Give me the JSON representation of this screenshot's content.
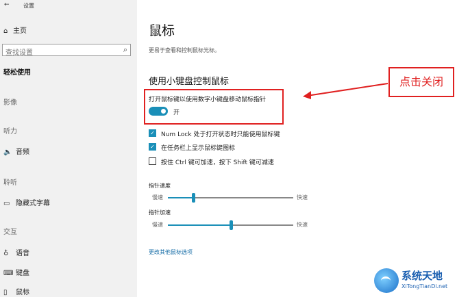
{
  "window": {
    "title": "设置",
    "back_glyph": "←"
  },
  "sidebar": {
    "home": "主页",
    "search_placeholder": "查找设置",
    "current_category": "轻松使用",
    "groups": [
      {
        "heading": "影像"
      },
      {
        "heading": "听力",
        "items": [
          {
            "label": "音频",
            "icon": "speaker-icon"
          }
        ]
      },
      {
        "heading": "聆听",
        "items": [
          {
            "label": "隐藏式字幕",
            "icon": "captions-icon"
          }
        ]
      },
      {
        "heading": "交互",
        "items": [
          {
            "label": "语音",
            "icon": "microphone-icon"
          },
          {
            "label": "键盘",
            "icon": "keyboard-icon"
          },
          {
            "label": "鼠标",
            "icon": "mouse-icon"
          }
        ]
      }
    ]
  },
  "main": {
    "title": "鼠标",
    "description": "更易于查看和控制鼠标光标。",
    "section_title": "使用小键盘控制鼠标",
    "toggle": {
      "label": "打开鼠标键以使用数字小键盘移动鼠标指针",
      "state": "开",
      "on": true
    },
    "checkboxes": [
      {
        "label": "Num Lock 处于打开状态时只能使用鼠标键",
        "checked": true
      },
      {
        "label": "在任务栏上显示鼠标键图标",
        "checked": true
      },
      {
        "label": "按住 Ctrl 键可加速，按下 Shift 键可减速",
        "checked": false
      }
    ],
    "sliders": [
      {
        "label": "指针速度",
        "min_label": "慢速",
        "max_label": "快速",
        "value_fraction": 0.2
      },
      {
        "label": "指针加速",
        "min_label": "慢速",
        "max_label": "快速",
        "value_fraction": 0.5
      }
    ],
    "link": "更改其他鼠标选项"
  },
  "annotation": {
    "callout": "点击关闭",
    "color": "#e02020"
  },
  "watermark": {
    "text": "系统天地",
    "url_text": "XiTongTianDi.net"
  },
  "colors": {
    "accent": "#1a8fb8",
    "sidebar_bg": "#f1f1f1"
  }
}
